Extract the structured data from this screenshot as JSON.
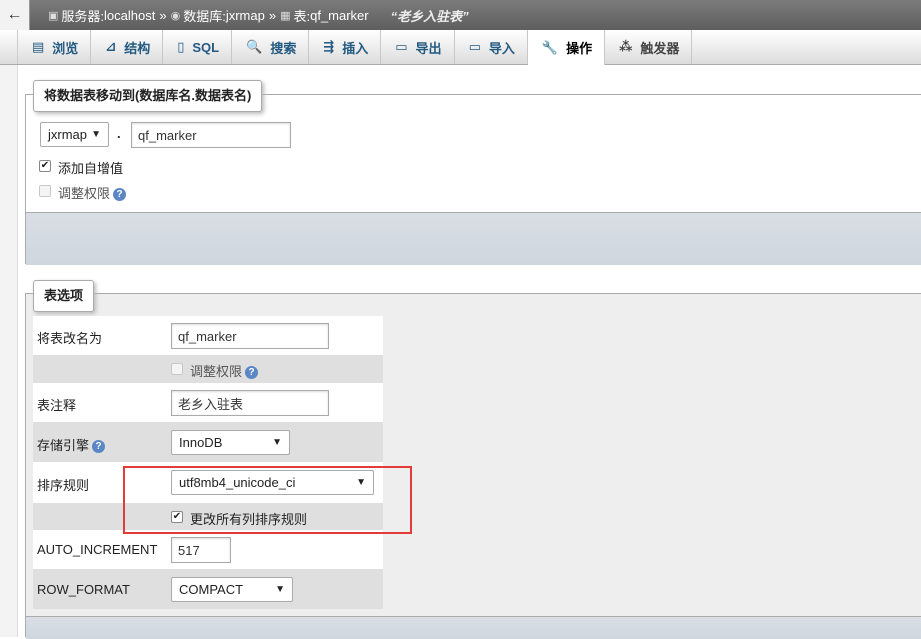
{
  "breadcrumb": {
    "back": "←",
    "server_label": "服务器:",
    "server": "localhost",
    "db_label": "数据库:",
    "db": "jxrmap",
    "table_label": "表:",
    "table": "qf_marker",
    "separator": "»",
    "comment": "“老乡入驻表”"
  },
  "tabs": [
    {
      "label": "浏览",
      "icon": "▤"
    },
    {
      "label": "结构",
      "icon": "⊿"
    },
    {
      "label": "SQL",
      "icon": "▯"
    },
    {
      "label": "搜索",
      "icon": "🔍"
    },
    {
      "label": "插入",
      "icon": "⇶"
    },
    {
      "label": "导出",
      "icon": "▭"
    },
    {
      "label": "导入",
      "icon": "▭"
    },
    {
      "label": "操作",
      "icon": "🔧"
    },
    {
      "label": "触发器",
      "icon": "⁂"
    }
  ],
  "move_section": {
    "legend": "将数据表移动到(数据库名.数据表名)",
    "db_select": "jxrmap",
    "dot": ".",
    "table_name": "qf_marker",
    "auto_increment_label": "添加自增值",
    "adjust_privileges_label": "调整权限"
  },
  "options_section": {
    "legend": "表选项",
    "rename_label": "将表改名为",
    "rename_value": "qf_marker",
    "adjust_privileges_label": "调整权限",
    "comment_label": "表注释",
    "comment_value": "老乡入驻表",
    "engine_label": "存储引擎",
    "engine_value": "InnoDB",
    "collation_label": "排序规则",
    "collation_value": "utf8mb4_unicode_ci",
    "change_all_collation_label": "更改所有列排序规则",
    "auto_increment_label": "AUTO_INCREMENT",
    "auto_increment_value": "517",
    "row_format_label": "ROW_FORMAT",
    "row_format_value": "COMPACT"
  },
  "icons": {
    "help": "?",
    "dropdown": "▼",
    "check": "✔"
  }
}
